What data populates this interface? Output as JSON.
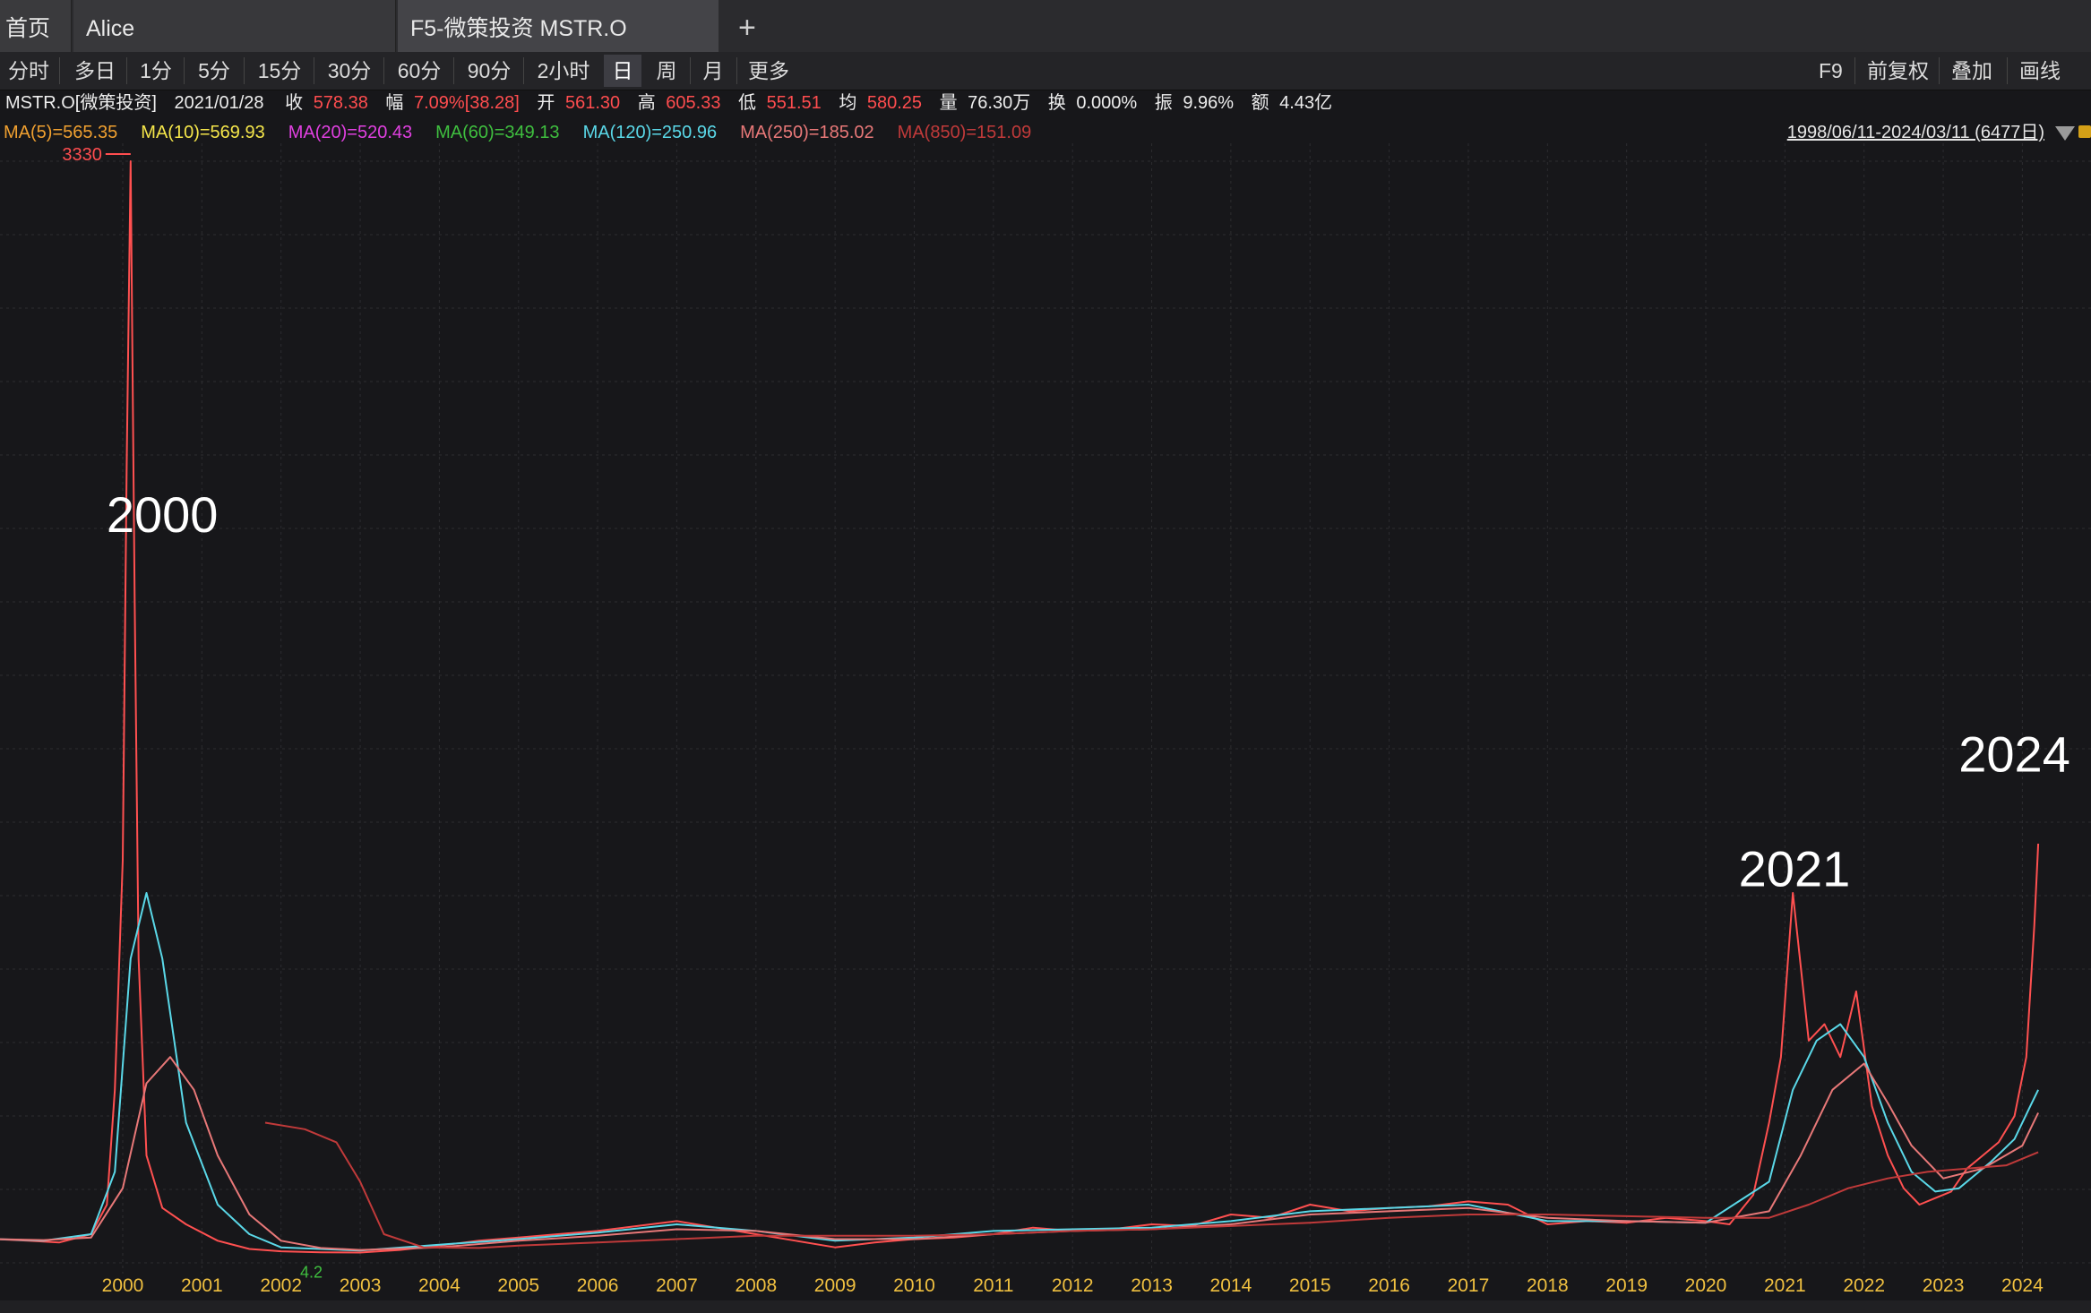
{
  "tabs": {
    "home": "首页",
    "alice": "Alice",
    "stock": "F5-微策投资 MSTR.O",
    "add": "+"
  },
  "periods": [
    "分时",
    "多日",
    "1分",
    "5分",
    "15分",
    "30分",
    "60分",
    "90分",
    "2小时",
    "日",
    "周",
    "月",
    "更多"
  ],
  "active_period": "日",
  "right_tools": {
    "f9": "F9",
    "adjust": "前复权",
    "overlay": "叠加",
    "draw": "画线"
  },
  "info": {
    "symbol": "MSTR.O[微策投资]",
    "date": "2021/01/28",
    "close_label": "收",
    "close": "578.38",
    "change_label": "幅",
    "change": "7.09%[38.28]",
    "open_label": "开",
    "open": "561.30",
    "high_label": "高",
    "high": "605.33",
    "low_label": "低",
    "low": "551.51",
    "avg_label": "均",
    "avg": "580.25",
    "volume_label": "量",
    "volume": "76.30万",
    "turnover_label": "换",
    "turnover": "0.000%",
    "amplitude_label": "振",
    "amplitude": "9.96%",
    "amount_label": "额",
    "amount": "4.43亿"
  },
  "ma": [
    {
      "label": "MA(5)=565.35",
      "color": "#f0a030"
    },
    {
      "label": "MA(10)=569.93",
      "color": "#f5e64a"
    },
    {
      "label": "MA(20)=520.43",
      "color": "#e040e0"
    },
    {
      "label": "MA(60)=349.13",
      "color": "#3fbf3f"
    },
    {
      "label": "MA(120)=250.96",
      "color": "#5ad8e8"
    },
    {
      "label": "MA(250)=185.02",
      "color": "#e87878"
    },
    {
      "label": "MA(850)=151.09",
      "color": "#c03a3a"
    }
  ],
  "range_text": "1998/06/11-2024/03/11 (6477日)",
  "chart_data": {
    "type": "line",
    "x_ticks": [
      "2000",
      "2001",
      "2002",
      "2003",
      "2004",
      "2005",
      "2006",
      "2007",
      "2008",
      "2009",
      "2010",
      "2011",
      "2012",
      "2013",
      "2014",
      "2015",
      "2016",
      "2017",
      "2018",
      "2019",
      "2020",
      "2021",
      "2022",
      "2023",
      "2024"
    ],
    "max_marker": "3330",
    "min_marker": "4.2",
    "annotations": [
      "2000",
      "2021",
      "2024"
    ],
    "series": [
      {
        "color": "#ff5050",
        "x": [
          1998.4,
          1998.8,
          1999.2,
          1999.6,
          1999.8,
          1999.9,
          2000.0,
          2000.05,
          2000.1,
          2000.15,
          2000.2,
          2000.3,
          2000.5,
          2000.8,
          2001.2,
          2001.6,
          2002.0,
          2002.5,
          2003.0,
          2003.5,
          2004.0,
          2004.5,
          2005.0,
          2005.5,
          2006.0,
          2006.5,
          2007.0,
          2007.5,
          2008.0,
          2008.5,
          2009.0,
          2009.5,
          2010.0,
          2010.5,
          2011.0,
          2011.5,
          2012.0,
          2012.5,
          2013.0,
          2013.5,
          2014.0,
          2014.5,
          2015.0,
          2015.5,
          2016.0,
          2016.5,
          2017.0,
          2017.5,
          2018.0,
          2018.5,
          2019.0,
          2019.5,
          2020.0,
          2020.3,
          2020.6,
          2020.8,
          2020.95,
          2021.1,
          2021.3,
          2021.5,
          2021.7,
          2021.9,
          2022.1,
          2022.3,
          2022.5,
          2022.7,
          2022.9,
          2023.1,
          2023.3,
          2023.5,
          2023.7,
          2023.9,
          2024.05,
          2024.15,
          2024.2
        ],
        "y": [
          45,
          40,
          35,
          60,
          150,
          500,
          1200,
          2400,
          3330,
          2000,
          900,
          300,
          140,
          90,
          40,
          15,
          8,
          5,
          4.2,
          12,
          25,
          40,
          50,
          60,
          70,
          85,
          100,
          80,
          60,
          40,
          20,
          35,
          45,
          50,
          60,
          80,
          70,
          75,
          90,
          85,
          120,
          110,
          150,
          130,
          140,
          145,
          160,
          150,
          90,
          100,
          95,
          110,
          100,
          90,
          180,
          400,
          600,
          1100,
          650,
          700,
          600,
          800,
          450,
          300,
          200,
          150,
          170,
          190,
          260,
          300,
          340,
          420,
          600,
          1000,
          1250
        ]
      },
      {
        "color": "#5ad8e8",
        "x": [
          1998.4,
          1999.0,
          1999.6,
          1999.9,
          2000.1,
          2000.3,
          2000.5,
          2000.8,
          2001.2,
          2001.6,
          2002.0,
          2003.0,
          2004.0,
          2005.0,
          2006.0,
          2007.0,
          2008.0,
          2009.0,
          2010.0,
          2011.0,
          2012.0,
          2013.0,
          2014.0,
          2015.0,
          2016.0,
          2017.0,
          2018.0,
          2019.0,
          2020.0,
          2020.8,
          2021.1,
          2021.4,
          2021.7,
          2022.0,
          2022.3,
          2022.6,
          2022.9,
          2023.2,
          2023.6,
          2023.9,
          2024.1,
          2024.2
        ],
        "y": [
          45,
          40,
          60,
          250,
          900,
          1100,
          900,
          400,
          150,
          60,
          20,
          10,
          28,
          45,
          65,
          90,
          70,
          40,
          50,
          70,
          75,
          80,
          100,
          130,
          140,
          150,
          100,
          100,
          95,
          220,
          500,
          650,
          700,
          600,
          400,
          250,
          190,
          200,
          280,
          350,
          450,
          500
        ]
      },
      {
        "color": "#e87878",
        "x": [
          1998.4,
          1999.0,
          1999.6,
          2000.0,
          2000.3,
          2000.6,
          2000.9,
          2001.2,
          2001.6,
          2002.0,
          2002.5,
          2003.0,
          2004.0,
          2005.0,
          2006.0,
          2007.0,
          2008.0,
          2009.0,
          2010.0,
          2011.0,
          2012.0,
          2013.0,
          2014.0,
          2015.0,
          2016.0,
          2017.0,
          2018.0,
          2019.0,
          2020.0,
          2020.8,
          2021.2,
          2021.6,
          2022.0,
          2022.3,
          2022.6,
          2023.0,
          2023.5,
          2024.0,
          2024.2
        ],
        "y": [
          45,
          42,
          50,
          200,
          520,
          600,
          500,
          300,
          120,
          40,
          18,
          12,
          20,
          40,
          55,
          75,
          70,
          45,
          45,
          60,
          70,
          75,
          90,
          120,
          130,
          140,
          110,
          100,
          95,
          130,
          300,
          500,
          580,
          460,
          330,
          230,
          260,
          330,
          430
        ]
      },
      {
        "color": "#c03a3a",
        "x": [
          2001.8,
          2002.3,
          2002.7,
          2003.0,
          2003.3,
          2003.8,
          2004.5,
          2005.0,
          2006.0,
          2007.0,
          2008.0,
          2009.0,
          2010.0,
          2011.0,
          2012.0,
          2013.0,
          2014.0,
          2015.0,
          2016.0,
          2017.0,
          2018.0,
          2019.0,
          2020.0,
          2020.8,
          2021.3,
          2021.8,
          2022.3,
          2022.8,
          2023.3,
          2023.8,
          2024.2
        ],
        "y": [
          400,
          380,
          340,
          220,
          60,
          20,
          18,
          25,
          35,
          45,
          55,
          55,
          55,
          60,
          70,
          75,
          85,
          95,
          110,
          120,
          120,
          115,
          110,
          110,
          150,
          200,
          230,
          250,
          260,
          270,
          310
        ]
      }
    ]
  }
}
